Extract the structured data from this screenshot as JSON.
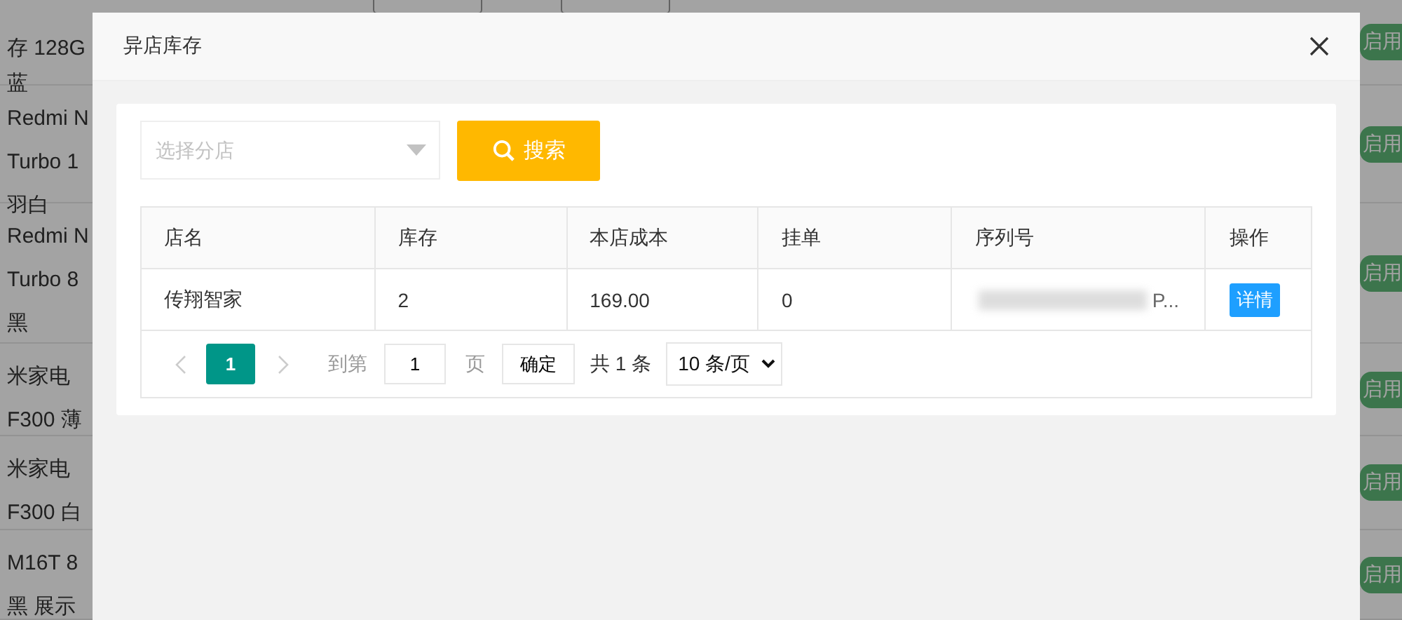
{
  "background": {
    "products": [
      {
        "lines": [
          "存 128G",
          "蓝"
        ]
      },
      {
        "lines": [
          "Redmi N",
          "Turbo 1",
          "羽白"
        ]
      },
      {
        "lines": [
          "Redmi N",
          "Turbo 8",
          "黑"
        ]
      },
      {
        "lines": [
          "米家电",
          "F300 薄"
        ]
      },
      {
        "lines": [
          "米家电",
          "F300 白"
        ]
      },
      {
        "lines": [
          "M16T 8",
          "黑 展示"
        ]
      }
    ],
    "status_badges": [
      "启用",
      "启用",
      "启用",
      "启用",
      "启用",
      "启用"
    ]
  },
  "dialog": {
    "title": "异店库存",
    "branch_select": {
      "placeholder": "选择分店"
    },
    "search_button": "搜索",
    "table": {
      "columns": [
        "店名",
        "库存",
        "本店成本",
        "挂单",
        "序列号",
        "操作"
      ],
      "rows": [
        {
          "store": "传翔智家",
          "stock": "2",
          "cost": "169.00",
          "pending": "0",
          "serial": "P...",
          "action": "详情"
        }
      ]
    },
    "pagination": {
      "pages": [
        {
          "label": "1",
          "selected": true
        }
      ],
      "goto_label": "到第",
      "goto_value": "1",
      "page_unit": "页",
      "confirm": "确定",
      "total": "共 1 条",
      "page_size": "10 条/页"
    }
  }
}
